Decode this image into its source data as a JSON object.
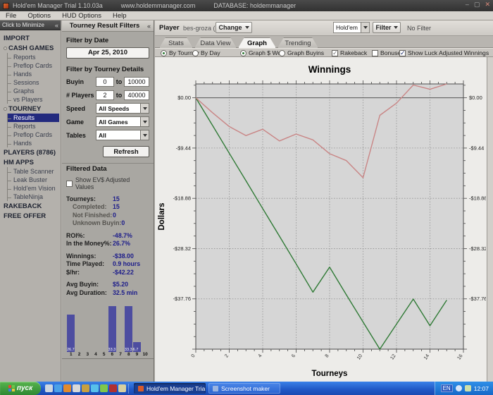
{
  "title_bar": {
    "title": "Hold'em Manager Trial 1.10.03a",
    "url": "www.holdemmanager.com",
    "database": "DATABASE: holdemmanager",
    "controls": {
      "minimize": "–",
      "maximize": "▢",
      "close": "✕"
    }
  },
  "menu_bar": {
    "items": [
      "File",
      "Options",
      "HUD Options",
      "Help"
    ]
  },
  "sidebar": {
    "minimize_label": "Click to Minimize",
    "minimize_icon": "«",
    "tree": [
      {
        "label": "IMPORT",
        "bullet": false,
        "children": []
      },
      {
        "label": "CASH GAMES",
        "bullet": true,
        "children": [
          {
            "label": "Reports"
          },
          {
            "label": "Preflop Cards"
          },
          {
            "label": "Hands"
          },
          {
            "label": "Sessions"
          },
          {
            "label": "Graphs"
          },
          {
            "label": "vs Players"
          }
        ]
      },
      {
        "label": "TOURNEY",
        "bullet": true,
        "children": [
          {
            "label": "Results",
            "selected": true
          },
          {
            "label": "Reports"
          },
          {
            "label": "Preflop Cards"
          },
          {
            "label": "Hands"
          }
        ]
      },
      {
        "label": "PLAYERS (8786)",
        "bullet": false,
        "children": []
      },
      {
        "label": "HM APPS",
        "bullet": false,
        "children": [
          {
            "label": "Table Scanner"
          },
          {
            "label": "Leak Buster"
          },
          {
            "label": "Hold'em Vision"
          },
          {
            "label": "TableNinja"
          }
        ]
      },
      {
        "label": "RAKEBACK",
        "bullet": false,
        "children": []
      },
      {
        "label": "FREE OFFER",
        "bullet": false,
        "children": []
      }
    ]
  },
  "filters_panel": {
    "header": "Tourney Result Filters",
    "collapse_icon": "«",
    "date_label": "Filter by Date",
    "date_value": "Apr 25, 2010",
    "details_label": "Filter by Tourney Details",
    "rows": {
      "buyin": {
        "label": "Buyin",
        "from": "0",
        "sep": "to",
        "to": "10000"
      },
      "players": {
        "label": "# Players",
        "from": "2",
        "sep": "to",
        "to": "40000"
      },
      "speed": {
        "label": "Speed",
        "value": "All Speeds"
      },
      "game": {
        "label": "Game",
        "value": "All Games"
      },
      "tables": {
        "label": "Tables",
        "value": "All"
      }
    },
    "refresh_label": "Refresh",
    "filtered_label": "Filtered Data",
    "ev_checkbox": {
      "label": "Show EV$ Adjusted Values",
      "checked": false
    },
    "stats": [
      {
        "label": "Tourneys:",
        "value": "15",
        "indent": false,
        "gap": false
      },
      {
        "label": "Completed:",
        "value": "15",
        "indent": true,
        "gap": false
      },
      {
        "label": "Not Finished:",
        "value": "0",
        "indent": true,
        "gap": false
      },
      {
        "label": "Unknown Buyin:",
        "value": "0",
        "indent": true,
        "gap": false
      },
      {
        "label": "ROI%:",
        "value": "-48.7%",
        "indent": false,
        "gap": true
      },
      {
        "label": "In the Money%:",
        "value": "26.7%",
        "indent": false,
        "gap": false
      },
      {
        "label": "Winnings:",
        "value": "-$38.00",
        "indent": false,
        "gap": true
      },
      {
        "label": "Time Played:",
        "value": "0.9 hours",
        "indent": false,
        "gap": false
      },
      {
        "label": "$/hr:",
        "value": "-$42.22",
        "indent": false,
        "gap": false
      },
      {
        "label": "Avg Buyin:",
        "value": "$5.20",
        "indent": false,
        "gap": true
      },
      {
        "label": "Avg Duration:",
        "value": "32.5 min",
        "indent": false,
        "gap": false
      }
    ]
  },
  "player_bar": {
    "label": "Player",
    "name": "bes-groza (PS)",
    "change_label": "Change",
    "game_value": "Hold'em",
    "filter_label": "Filter",
    "filter_status": "No Filter"
  },
  "tabs": [
    {
      "label": "Stats",
      "active": false
    },
    {
      "label": "Data View",
      "active": false
    },
    {
      "label": "Graph",
      "active": true
    },
    {
      "label": "Trending",
      "active": false
    }
  ],
  "options": {
    "radios": [
      {
        "label": "By Tourney",
        "selected": true
      },
      {
        "label": "By Day",
        "selected": false
      },
      {
        "label": "Graph $ Won",
        "selected": true
      },
      {
        "label": "Graph Buyins",
        "selected": false
      }
    ],
    "checkboxes": [
      {
        "label": "Rakeback",
        "checked": true,
        "gray": true
      },
      {
        "label": "Bonuses",
        "checked": false,
        "gray": false
      },
      {
        "label": "Show Luck Adjusted Winnings",
        "checked": true,
        "gray": false
      }
    ]
  },
  "chart_data": [
    {
      "type": "line",
      "title": "Winnings",
      "xlabel": "Tourneys",
      "ylabel": "Dollars",
      "xlim": [
        0,
        16
      ],
      "ylim": [
        -47.2,
        2.6
      ],
      "x_ticks": [
        0,
        2,
        4,
        6,
        8,
        10,
        12,
        14,
        16
      ],
      "y_ticks": [
        {
          "value": 0,
          "label": "$0.00"
        },
        {
          "value": -9.44,
          "label": "-$9.44"
        },
        {
          "value": -18.88,
          "label": "-$18.88"
        },
        {
          "value": -28.32,
          "label": "-$28.32"
        },
        {
          "value": -37.76,
          "label": "-$37.76"
        }
      ],
      "x": [
        0,
        1,
        2,
        3,
        4,
        5,
        6,
        7,
        8,
        9,
        10,
        11,
        12,
        13,
        14,
        15
      ],
      "series": [
        {
          "name": "Winnings",
          "color": "#2f7a35",
          "values": [
            0,
            -5.2,
            -10.4,
            -15.6,
            -20.8,
            -26.0,
            -31.2,
            -36.5,
            -31.8,
            -37.0,
            -42.1,
            -47.2,
            -42.5,
            -37.8,
            -42.8,
            -38.0
          ]
        },
        {
          "name": "Luck Adjusted Winnings",
          "color": "#c98585",
          "values": [
            0,
            -2.8,
            -5.4,
            -7.1,
            -5.9,
            -8.1,
            -6.8,
            -7.9,
            -10.5,
            -11.8,
            -15.0,
            -3.3,
            -1.0,
            2.4,
            1.6,
            2.6
          ]
        }
      ],
      "plot_bg": "#d6d6d6",
      "grid": true,
      "legend": "none",
      "zero_line": true
    },
    {
      "type": "bar",
      "categories": [
        "1",
        "2",
        "3",
        "4",
        "5",
        "6",
        "7",
        "8",
        "9",
        "10"
      ],
      "values": [
        26.7,
        0,
        0,
        0,
        0,
        33.3,
        0,
        33.3,
        6.7,
        0
      ],
      "value_labels": [
        "26.7",
        "",
        "",
        "",
        "",
        "33.3",
        "",
        "33.3",
        "6.7",
        ""
      ],
      "bar_color": "#4d4da0"
    }
  ],
  "taskbar": {
    "start_label": "пуск",
    "quick_launch": [
      {
        "name": "show-desktop-icon",
        "color": "#cdd6e0"
      },
      {
        "name": "ie-icon",
        "color": "#4aa0e8"
      },
      {
        "name": "firefox-icon",
        "color": "#e08a2e"
      },
      {
        "name": "chrome-icon",
        "color": "#d8d8d8"
      },
      {
        "name": "mail-icon",
        "color": "#c8a040"
      },
      {
        "name": "skype-icon",
        "color": "#57c0ea"
      },
      {
        "name": "icq-icon",
        "color": "#7fc84a"
      },
      {
        "name": "opera-icon",
        "color": "#b03030"
      },
      {
        "name": "folder-icon",
        "color": "#d6cfa0"
      }
    ],
    "tasks": [
      {
        "label": "Hold'em Manager Tria...",
        "active": true,
        "icon_color": "#d85a2a"
      },
      {
        "label": "Screenshot maker",
        "active": false,
        "icon_color": "#9ab4e0"
      }
    ],
    "tray": {
      "lang": "EN",
      "clock": "12:07"
    }
  }
}
